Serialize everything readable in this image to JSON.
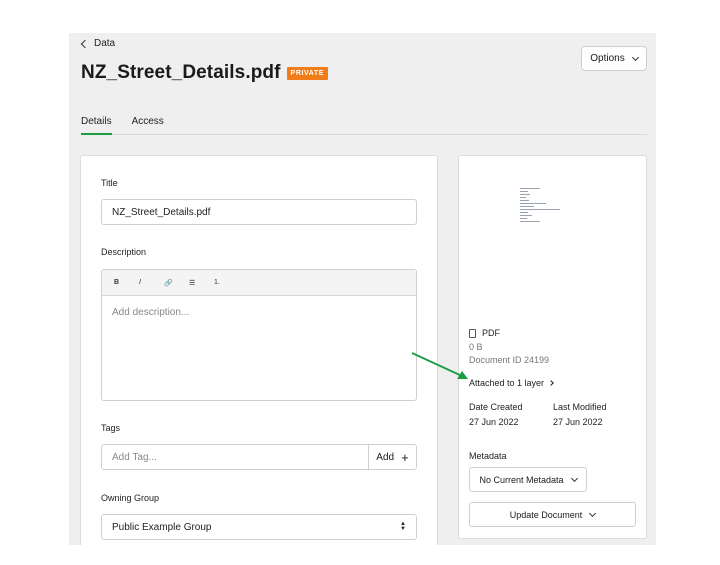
{
  "nav": {
    "back_label": "Data"
  },
  "header": {
    "title": "NZ_Street_Details.pdf",
    "badge": "PRIVATE",
    "options_label": "Options"
  },
  "tabs": [
    {
      "label": "Details",
      "active": true
    },
    {
      "label": "Access",
      "active": false
    }
  ],
  "form": {
    "title_label": "Title",
    "title_value": "NZ_Street_Details.pdf",
    "description_label": "Description",
    "description_placeholder": "Add description...",
    "toolbar": {
      "bold": "B",
      "italic": "I",
      "link": "🔗",
      "bullets": "☰",
      "numbered": "1."
    },
    "tags_label": "Tags",
    "tags_placeholder": "Add Tag...",
    "add_label": "Add",
    "add_symbol": "+",
    "group_label": "Owning Group",
    "group_value": "Public Example Group"
  },
  "doc": {
    "type": "PDF",
    "size": "0 B",
    "document_id": "Document ID 24199",
    "layers_link": "Attached to 1 layer",
    "date_created_label": "Date Created",
    "date_created": "27 Jun 2022",
    "last_modified_label": "Last Modified",
    "last_modified": "27 Jun 2022",
    "metadata_label": "Metadata",
    "metadata_button": "No Current Metadata",
    "update_button": "Update Document"
  },
  "colors": {
    "accent": "#1a9d44",
    "badge": "#f07c1a",
    "arrow": "#1a9d44"
  },
  "icons": {
    "back": "chevron-left-icon",
    "file": "file-icon",
    "layers": "chevron-right-icon",
    "caret": "chevron-down-icon",
    "arrow": "annotation-arrow-icon"
  }
}
